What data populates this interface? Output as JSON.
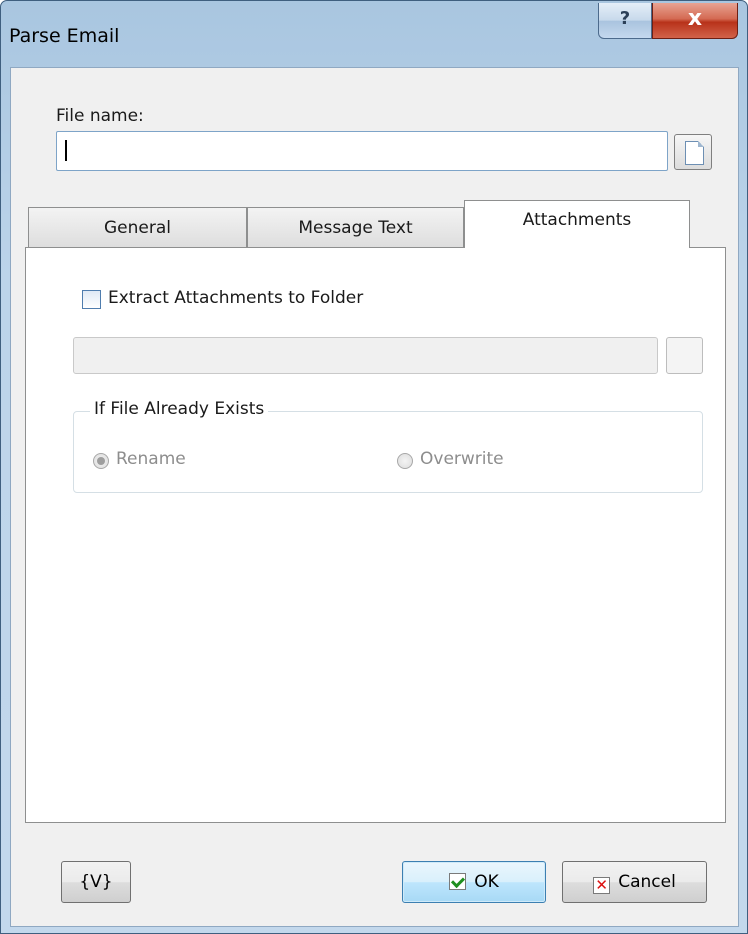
{
  "window": {
    "title": "Parse Email",
    "help_label": "?",
    "close_label": "x"
  },
  "file": {
    "label": "File name:",
    "value": ""
  },
  "tabs": [
    {
      "label": "General",
      "active": false
    },
    {
      "label": "Message Text",
      "active": false
    },
    {
      "label": "Attachments",
      "active": true
    }
  ],
  "attachments": {
    "extract_label": "Extract Attachments to Folder",
    "extract_checked": false,
    "folder_value": "",
    "group_title": "If File Already Exists",
    "options": [
      {
        "label": "Rename",
        "checked": true,
        "enabled": false
      },
      {
        "label": "Overwrite",
        "checked": false,
        "enabled": false
      }
    ]
  },
  "buttons": {
    "variables_label": "{V}",
    "ok_label": "OK",
    "cancel_label": "Cancel"
  },
  "icons": {
    "file_browse": "document-icon",
    "ok": "checkmark-icon",
    "cancel": "x-icon"
  }
}
